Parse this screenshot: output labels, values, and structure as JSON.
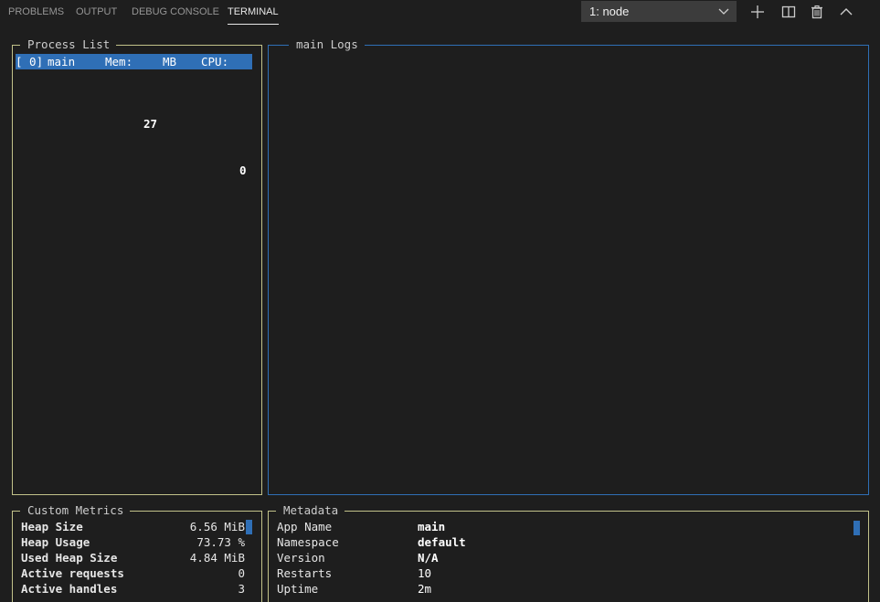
{
  "tabs": [
    {
      "label": "PROBLEMS"
    },
    {
      "label": "OUTPUT"
    },
    {
      "label": "DEBUG CONSOLE"
    },
    {
      "label": "TERMINAL",
      "active": true
    }
  ],
  "terminal_select": {
    "selected": "1: node"
  },
  "toolbar_icons": [
    "plus-icon",
    "split-icon",
    "trash-icon",
    "chevron-up-icon"
  ],
  "process_list": {
    "title": "Process List",
    "rows": [
      {
        "id": "[ 0]",
        "name": "main",
        "mem_label": "Mem:",
        "mem_value": "27",
        "mem_unit": "MB",
        "cpu_label": "CPU:",
        "cpu_value": "0"
      }
    ]
  },
  "logs": {
    "title": "main Logs"
  },
  "custom_metrics": {
    "title": "Custom Metrics",
    "items": [
      {
        "label": "Heap Size",
        "value": "6.56 MiB"
      },
      {
        "label": "Heap Usage",
        "value": "73.73 %"
      },
      {
        "label": "Used Heap Size",
        "value": "4.84 MiB"
      },
      {
        "label": "Active requests",
        "value": "0"
      },
      {
        "label": "Active handles",
        "value": "3"
      }
    ]
  },
  "metadata": {
    "title": "Metadata",
    "items": [
      {
        "label": "App Name",
        "value": "main",
        "bold": true
      },
      {
        "label": "Namespace",
        "value": "default",
        "bold": true
      },
      {
        "label": "Version",
        "value": "N/A",
        "bold": true
      },
      {
        "label": "Restarts",
        "value": "10",
        "bold": false
      },
      {
        "label": "Uptime",
        "value": "2m",
        "bold": false
      }
    ]
  },
  "colors": {
    "background": "#1e1e1e",
    "selection": "#2f6fb6",
    "border": "#c2c28a",
    "focus_border": "#2f6fb6"
  }
}
